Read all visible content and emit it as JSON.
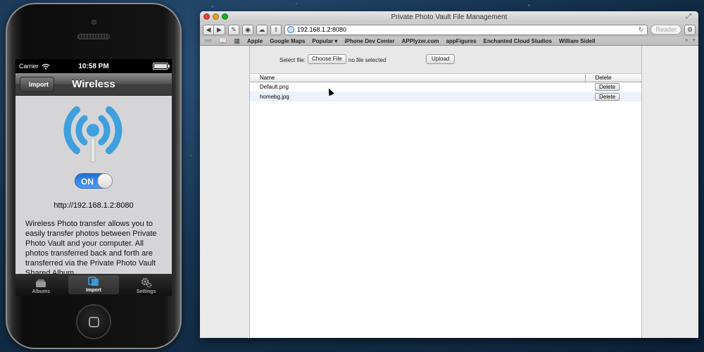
{
  "phone": {
    "status": {
      "carrier": "Carrier",
      "time": "10:58 PM",
      "battery_level": 1.0
    },
    "nav": {
      "back_label": "Import",
      "title": "Wireless"
    },
    "toggle_label": "ON",
    "url": "http://192.168.1.2:8080",
    "description": "Wireless Photo transfer allows you to easily transfer photos between Private Photo Vault and your computer. All photos transferred back and forth are transferred via the Private Photo Vault Shared Album.",
    "tabs": [
      {
        "label": "Albums",
        "icon": "albums-icon"
      },
      {
        "label": "Import",
        "icon": "import-icon"
      },
      {
        "label": "Settings",
        "icon": "gear-icon"
      }
    ],
    "colors": {
      "wifi_icon": "#3fa0dd",
      "toggle_on": "#2b7ee9"
    }
  },
  "browser": {
    "window_title": "Private Photo Vault File Management",
    "address": "192.168.1.2:8080",
    "reader_label": "Reader",
    "bookmarks": [
      "Apple",
      "Google Maps",
      "Popular ▾",
      "iPhone Dev Center",
      "APPlyzer.com",
      "appFigures",
      "Enchanted Cloud Studios",
      "William Sidell"
    ],
    "page": {
      "select_label": "Select file:",
      "choose_label": "Choose File",
      "no_file_text": "no file selected",
      "upload_label": "Upload",
      "columns": {
        "name": "Name",
        "delete": "Delete"
      },
      "files": [
        {
          "name": "Default.png",
          "action": "Delete"
        },
        {
          "name": "homebg.jpg",
          "action": "Delete"
        }
      ]
    }
  }
}
